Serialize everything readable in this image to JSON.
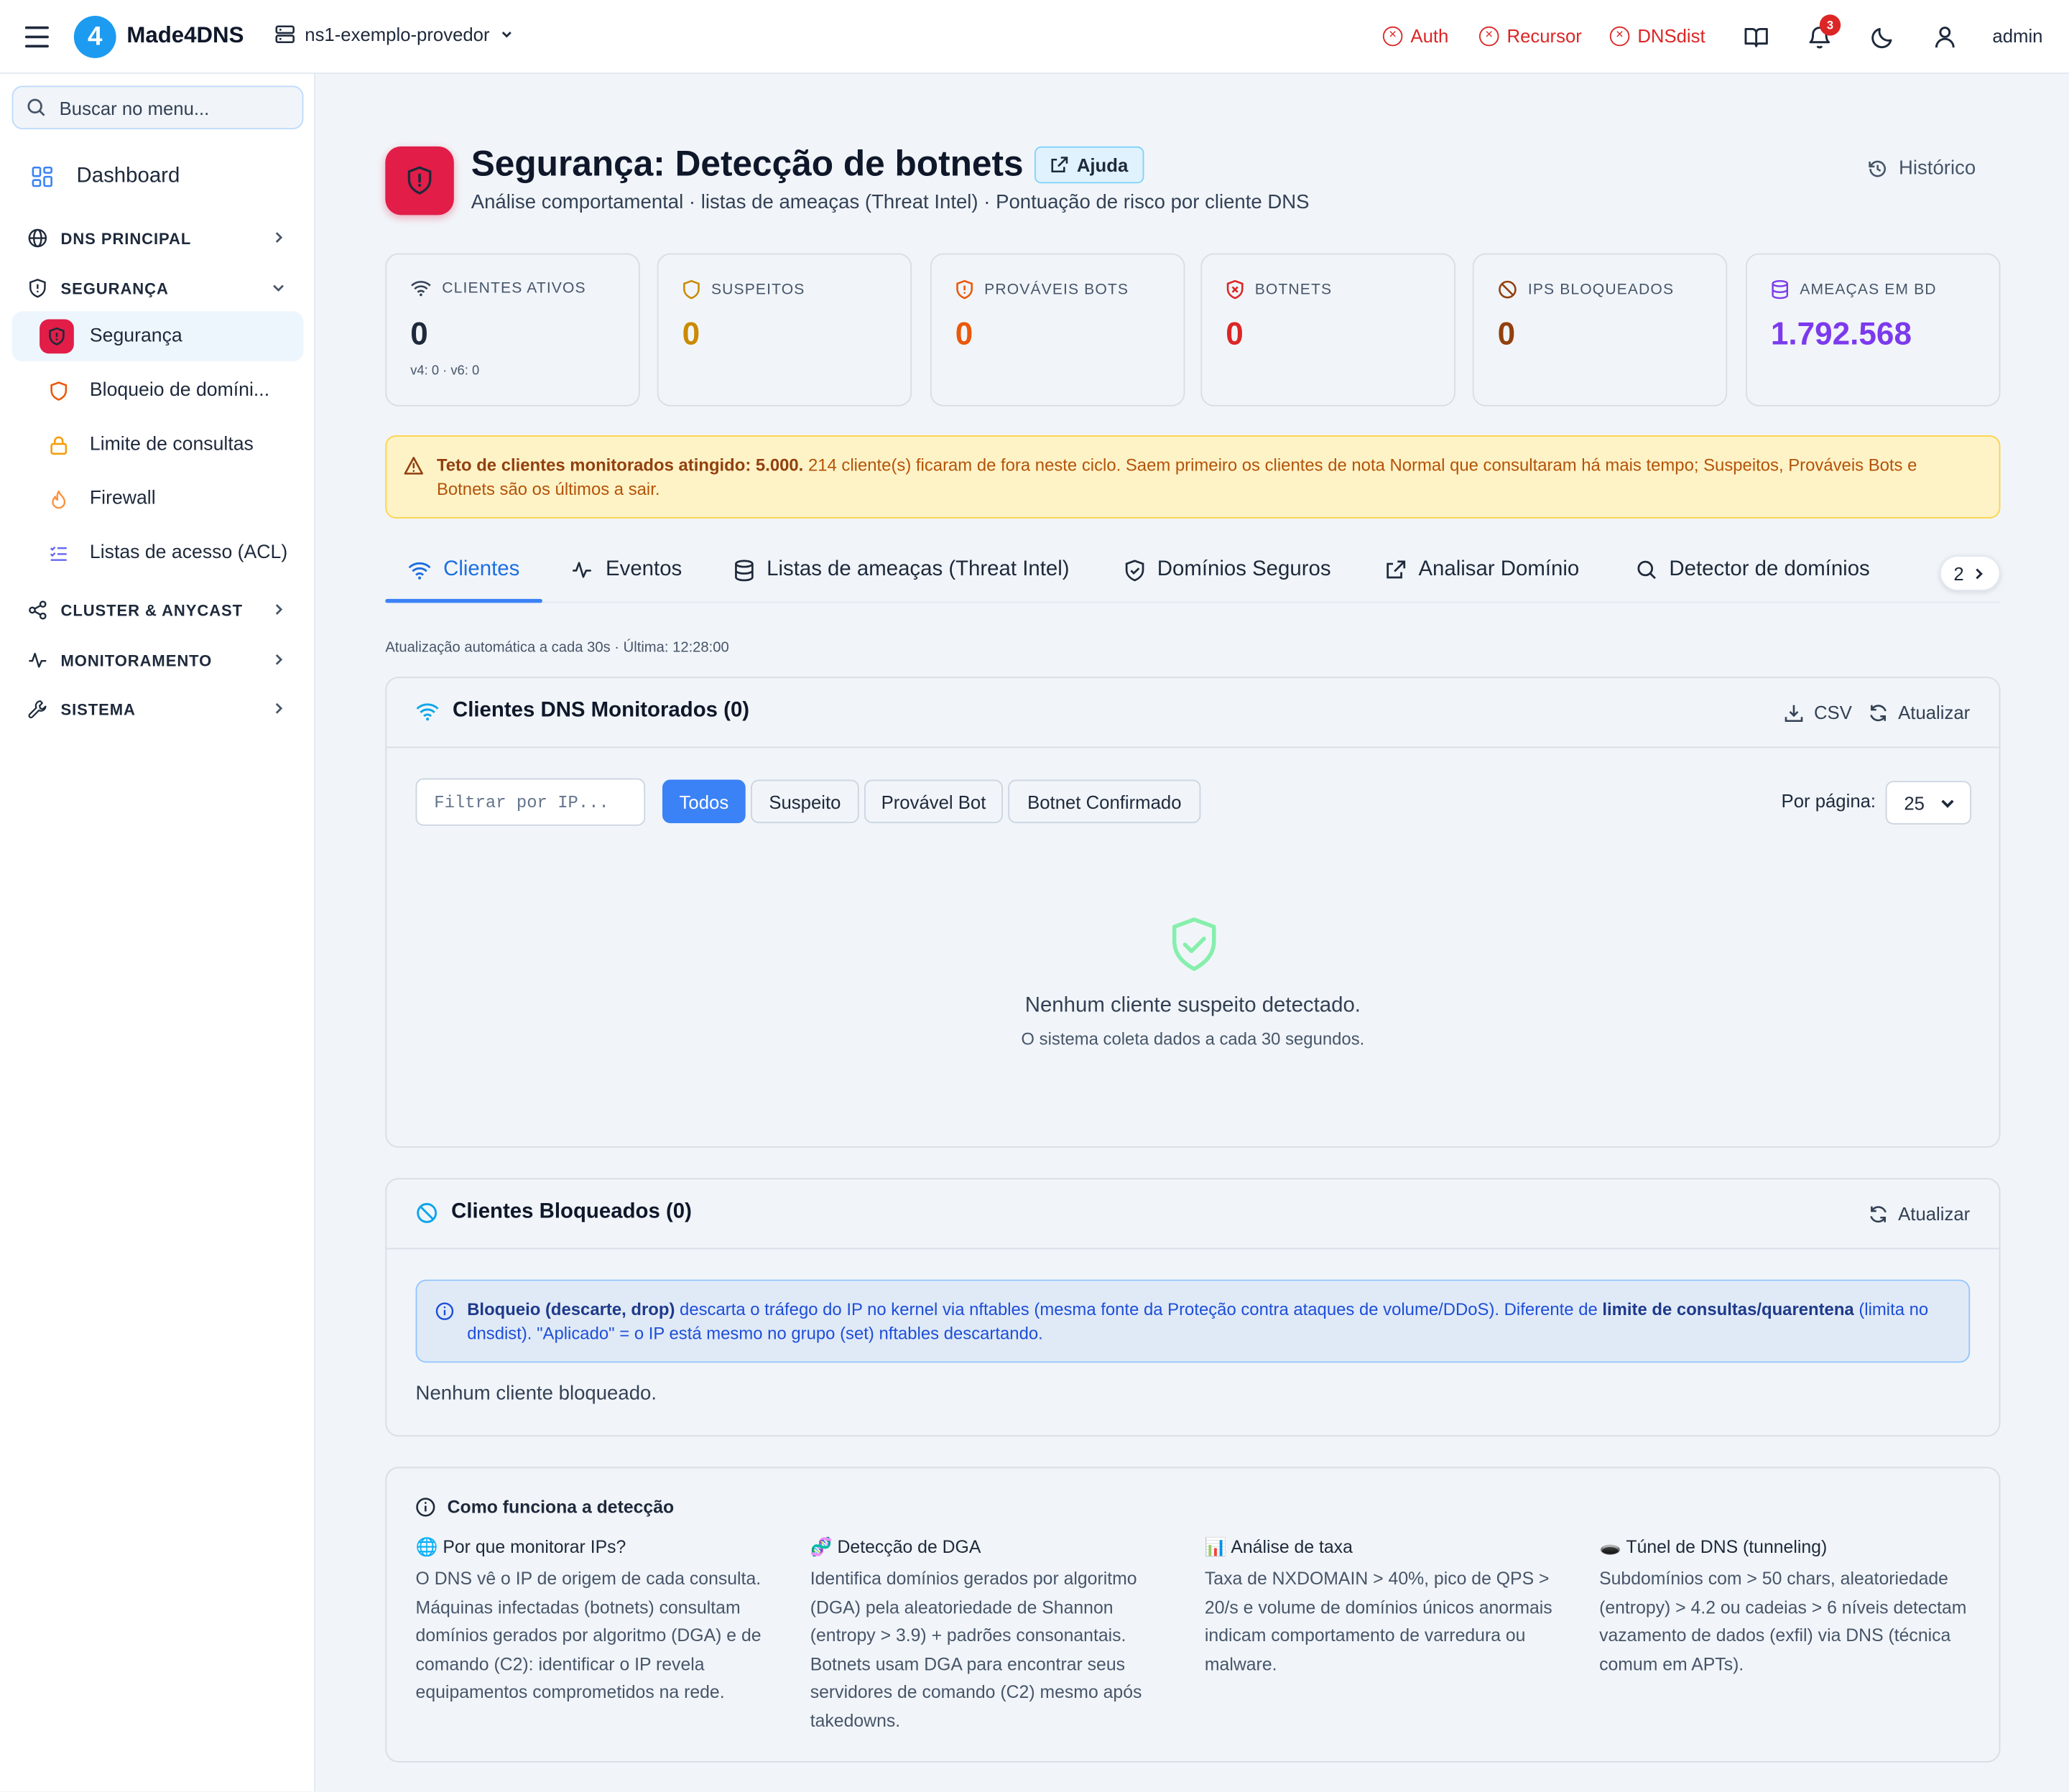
{
  "topbar": {
    "brand": "Made4DNS",
    "logo_letter": "4",
    "server": "ns1-exemplo-provedor",
    "services": [
      {
        "label": "Auth",
        "status": "error"
      },
      {
        "label": "Recursor",
        "status": "error"
      },
      {
        "label": "DNSdist",
        "status": "error"
      }
    ],
    "notifications_count": "3",
    "user": "admin"
  },
  "sidebar": {
    "search_placeholder": "Buscar no menu...",
    "dashboard": "Dashboard",
    "sections": {
      "dns": "DNS PRINCIPAL",
      "security": "SEGURANÇA",
      "cluster": "CLUSTER & ANYCAST",
      "monitor": "MONITORAMENTO",
      "system": "SISTEMA"
    },
    "items": [
      {
        "label": "Segurança",
        "active": true
      },
      {
        "label": "Bloqueio de domíni..."
      },
      {
        "label": "Limite de consultas"
      },
      {
        "label": "Firewall"
      },
      {
        "label": "Listas de acesso (ACL)"
      }
    ]
  },
  "header": {
    "title": "Segurança: Detecção de botnets",
    "help": "Ajuda",
    "subtitle": "Análise comportamental · listas de ameaças (Threat Intel) · Pontuação de risco por cliente DNS",
    "history": "Histórico"
  },
  "stats": [
    {
      "label": "CLIENTES ATIVOS",
      "value": "0",
      "sub": "v4: 0 · v6: 0",
      "color": "#1e293b"
    },
    {
      "label": "SUSPEITOS",
      "value": "0",
      "color": "#ca8a04"
    },
    {
      "label": "PROVÁVEIS BOTS",
      "value": "0",
      "color": "#ea580c"
    },
    {
      "label": "BOTNETS",
      "value": "0",
      "color": "#dc2626"
    },
    {
      "label": "IPS BLOQUEADOS",
      "value": "0",
      "color": "#92400e"
    },
    {
      "label": "AMEAÇAS EM BD",
      "value": "1.792.568",
      "color": "#7c3aed"
    }
  ],
  "warning": {
    "bold": "Teto de clientes monitorados atingido: 5.000.",
    "text": " 214 cliente(s) ficaram de fora neste ciclo. Saem primeiro os clientes de nota Normal que consultaram há mais tempo; Suspeitos, Prováveis Bots e Botnets são os últimos a sair."
  },
  "tabs": [
    {
      "label": "Clientes",
      "active": true
    },
    {
      "label": "Eventos"
    },
    {
      "label": "Listas de ameaças (Threat Intel)"
    },
    {
      "label": "Domínios Seguros"
    },
    {
      "label": "Analisar Domínio"
    },
    {
      "label": "Detector de domínios"
    }
  ],
  "tabs_more": "2",
  "auto_update": "Atualização automática a cada 30s · Última: 12:28:00",
  "monitored": {
    "title": "Clientes DNS Monitorados (0)",
    "csv": "CSV",
    "refresh": "Atualizar",
    "filter_placeholder": "Filtrar por IP...",
    "chips": [
      "Todos",
      "Suspeito",
      "Provável Bot",
      "Botnet Confirmado"
    ],
    "per_page_label": "Por página:",
    "per_page": "25",
    "empty_title": "Nenhum cliente suspeito detectado.",
    "empty_sub": "O sistema coleta dados a cada 30 segundos."
  },
  "blocked": {
    "title": "Clientes Bloqueados (0)",
    "refresh": "Atualizar",
    "info_b1": "Bloqueio (descarte, drop)",
    "info_t1": " descarta o tráfego do IP no kernel via nftables (mesma fonte da Proteção contra ataques de volume/DDoS). Diferente de ",
    "info_b2": "limite de consultas/quarentena",
    "info_t2": " (limita no dnsdist). \"Aplicado\" = o IP está mesmo no grupo (set) nftables descartando.",
    "none": "Nenhum cliente bloqueado."
  },
  "how": {
    "title": "Como funciona a detecção",
    "cols": [
      {
        "icon": "🌐",
        "title": "Por que monitorar IPs?",
        "text": "O DNS vê o IP de origem de cada consulta. Máquinas infectadas (botnets) consultam domínios gerados por algoritmo (DGA) e de comando (C2): identificar o IP revela equipamentos comprometidos na rede."
      },
      {
        "icon": "🧬",
        "title": "Detecção de DGA",
        "text": "Identifica domínios gerados por algoritmo (DGA) pela aleatoriedade de Shannon (entropy > 3.9) + padrões consonantais. Botnets usam DGA para encontrar seus servidores de comando (C2) mesmo após takedowns."
      },
      {
        "icon": "📊",
        "title": "Análise de taxa",
        "text": "Taxa de NXDOMAIN > 40%, pico de QPS > 20/s e volume de domínios únicos anormais indicam comportamento de varredura ou malware."
      },
      {
        "icon": "🕳️",
        "title": "Túnel de DNS (tunneling)",
        "text": "Subdomínios com > 50 chars, aleatoriedade (entropy) > 4.2 ou cadeias > 6 níveis detectam vazamento de dados (exfil) via DNS (técnica comum em APTs)."
      }
    ]
  }
}
